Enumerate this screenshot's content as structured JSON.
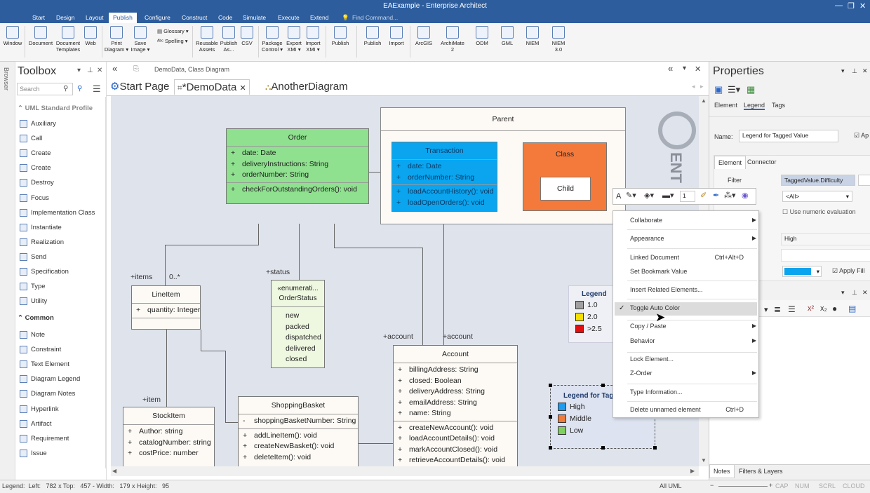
{
  "window": {
    "title": "EAExample - Enterprise Architect"
  },
  "menu_tabs": [
    "Start",
    "Design",
    "Layout",
    "Publish",
    "Configure",
    "Construct",
    "Code",
    "Simulate",
    "Execute",
    "Extend"
  ],
  "find_command": "Find Command...",
  "ribbon": {
    "buttons": [
      {
        "label": "Window",
        "sub": ""
      },
      {
        "label": "Document",
        "sub": ""
      },
      {
        "label": "Document",
        "sub": "Templates"
      },
      {
        "label": "Web",
        "sub": ""
      },
      {
        "label": "Print",
        "sub": "Diagram ▾"
      },
      {
        "label": "Save",
        "sub": "Image ▾"
      },
      {
        "label": "Reusable",
        "sub": "Assets"
      },
      {
        "label": "Publish",
        "sub": "As..."
      },
      {
        "label": "CSV",
        "sub": ""
      },
      {
        "label": "Package",
        "sub": "Control ▾"
      },
      {
        "label": "Export",
        "sub": "XMI ▾"
      },
      {
        "label": "Import",
        "sub": "XMI ▾"
      },
      {
        "label": "Publish",
        "sub": ""
      },
      {
        "label": "Publish",
        "sub": ""
      },
      {
        "label": "Import",
        "sub": ""
      },
      {
        "label": "ArcGIS",
        "sub": ""
      },
      {
        "label": "ArchiMate",
        "sub": "2"
      },
      {
        "label": "ODM",
        "sub": ""
      },
      {
        "label": "GML",
        "sub": ""
      },
      {
        "label": "NIEM",
        "sub": ""
      },
      {
        "label": "NIEM",
        "sub": "3.0"
      }
    ],
    "glossary": "Glossary ▾",
    "spelling": "Spelling ▾"
  },
  "browser_label": "Browser",
  "toolbox": {
    "title": "Toolbox",
    "search_placeholder": "Search",
    "profile_header": "UML Standard Profile",
    "profile_items": [
      "Auxiliary",
      "Call",
      "Create",
      "Create",
      "Destroy",
      "Focus",
      "Implementation Class",
      "Instantiate",
      "Realization",
      "Send",
      "Specification",
      "Type",
      "Utility"
    ],
    "common_header": "Common",
    "common_items": [
      "Note",
      "Constraint",
      "Text Element",
      "Diagram Legend",
      "Diagram Notes",
      "Hyperlink",
      "Artifact",
      "Requirement",
      "Issue"
    ]
  },
  "breadcrumb": "DemoData,  Class Diagram",
  "doc_tabs": [
    {
      "label": "Start Page"
    },
    {
      "label": "*DemoData"
    },
    {
      "label": "AnotherDiagram"
    }
  ],
  "diagram": {
    "parent": "Parent",
    "order": {
      "name": "Order",
      "attrs": [
        "date: Date",
        "deliveryInstructions: String",
        "orderNumber: String"
      ],
      "ops": [
        "checkForOutstandingOrders(): void"
      ]
    },
    "transaction": {
      "name": "Transaction",
      "attrs": [
        "date: Date",
        "orderNumber: String"
      ],
      "ops": [
        "loadAccountHistory(): void",
        "loadOpenOrders(): void"
      ]
    },
    "class_box": {
      "name": "Class",
      "child": "Child"
    },
    "lineitem": {
      "name": "LineItem",
      "attrs": [
        "quantity: Integer"
      ]
    },
    "orderstatus": {
      "stereo": "«enumerati...",
      "name": "OrderStatus",
      "values": [
        "new",
        "packed",
        "dispatched",
        "delivered",
        "closed"
      ]
    },
    "account": {
      "name": "Account",
      "attrs": [
        "billingAddress: String",
        "closed: Boolean",
        "deliveryAddress: String",
        "emailAddress: String",
        "name: String"
      ],
      "ops": [
        "createNewAccount(): void",
        "loadAccountDetails(): void",
        "markAccountClosed(): void",
        "retrieveAccountDetails(): void"
      ]
    },
    "stockitem": {
      "name": "StockItem",
      "attrs": [
        "Author: string",
        "catalogNumber: string",
        "costPrice: number"
      ]
    },
    "basket": {
      "name": "ShoppingBasket",
      "attrs": [
        "shoppingBasketNumber: String"
      ],
      "ops": [
        "addLineItem(): void",
        "createNewBasket(): void",
        "deleteItem(): void"
      ]
    },
    "labels": {
      "items": "+items",
      "mult": "0..*",
      "status": "+status",
      "account1": "+account",
      "account2": "+account",
      "item": "+item"
    },
    "legend1": {
      "title": "Legend",
      "items": [
        {
          "label": "1.0",
          "color": "#a0a0a0"
        },
        {
          "label": "2.0",
          "color": "#f5e000"
        },
        {
          "label": ">2.5",
          "color": "#e01010"
        }
      ]
    },
    "legend2": {
      "title": "Legend for Tag",
      "items": [
        {
          "label": "High",
          "color": "#1e9cf0"
        },
        {
          "label": "Middle",
          "color": "#f07c3c"
        },
        {
          "label": "Low",
          "color": "#80d060"
        }
      ]
    },
    "watermark": "ENT"
  },
  "context_menu": {
    "items": [
      {
        "label": "Collaborate",
        "shortcut": "",
        "arrow": true
      },
      {
        "label": "Appearance",
        "shortcut": "",
        "arrow": true
      },
      {
        "label": "Linked Document",
        "shortcut": "Ctrl+Alt+D",
        "arrow": false
      },
      {
        "label": "Set Bookmark Value",
        "shortcut": "",
        "arrow": false
      },
      {
        "label": "Insert Related Elements...",
        "shortcut": "",
        "arrow": false
      },
      {
        "label": "Toggle Auto Color",
        "shortcut": "",
        "arrow": false
      },
      {
        "label": "Copy / Paste",
        "shortcut": "",
        "arrow": true
      },
      {
        "label": "Behavior",
        "shortcut": "",
        "arrow": true
      },
      {
        "label": "Lock Element...",
        "shortcut": "",
        "arrow": false
      },
      {
        "label": "Z-Order",
        "shortcut": "",
        "arrow": true
      },
      {
        "label": "Type Information...",
        "shortcut": "",
        "arrow": false
      },
      {
        "label": "Delete unnamed element",
        "shortcut": "Ctrl+D",
        "arrow": false
      }
    ],
    "line_width": "1"
  },
  "properties": {
    "title": "Properties",
    "tabs": [
      "Element",
      "Legend",
      "Tags"
    ],
    "name_label": "Name:",
    "name_value": "Legend for Tagged Value",
    "apply_label": "Ap",
    "subtabs": [
      "Element",
      "Connector"
    ],
    "filter_label": "Filter",
    "filter_value": "TaggedValue.Difficulty",
    "all_value": "<All>",
    "numeric_label": "Use numeric evaluation",
    "high_value": "High",
    "apply_fill": "Apply Fill",
    "bottom_tabs": [
      "Notes",
      "Filters & Layers"
    ]
  },
  "status": {
    "left": "Legend:  Left:   782 x Top:   457 - Width:   179 x Height:   95",
    "mode": "All UML",
    "indicators": [
      "CAP",
      "NUM",
      "SCRL",
      "CLOUD"
    ]
  }
}
